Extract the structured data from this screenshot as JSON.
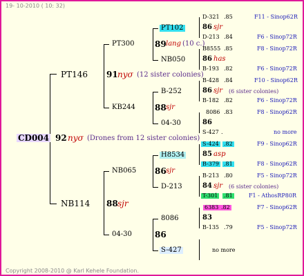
{
  "timestamp": "19- 10-2010 ( 10: 32)",
  "footer": "Copyright 2008-2010 @ Karl Kehele Foundation.",
  "root": {
    "id": "CD004",
    "year": "92",
    "race": "nyσ",
    "note": "(Drones from 12 sister colonies)"
  },
  "gen1": [
    {
      "id": "PT146",
      "year": "91",
      "race": "nyσ",
      "note": "(12 sister colonies)"
    },
    {
      "id": "NB114",
      "year": "88",
      "race": "sjr",
      "note": ""
    }
  ],
  "gen2": [
    {
      "id": "PT300",
      "year": "89",
      "race": "lang",
      "note": "(10 c.)"
    },
    {
      "id": "KB244",
      "year": "88",
      "race": "sjr",
      "note": ""
    },
    {
      "id": "NB065",
      "year": "86",
      "race": "sjr",
      "note": ""
    },
    {
      "id": "04-30",
      "year": "86",
      "race": "",
      "note": ""
    }
  ],
  "gen3": [
    {
      "id": "PT102",
      "year": "",
      "race": ""
    },
    {
      "id": "NB050",
      "year": "86",
      "race": "has"
    },
    {
      "id": "B-252",
      "year": "86",
      "race": "sjr",
      "note": "(6 sister colonies)"
    },
    {
      "id": "04-30",
      "year": "86",
      "race": ""
    },
    {
      "id": "H8534",
      "year": "85",
      "race": "asp"
    },
    {
      "id": "D-213",
      "year": "84",
      "race": "sjr",
      "note": "(6 sister colonies)"
    },
    {
      "id": "8086",
      "year": "83",
      "race": ""
    },
    {
      "id": "S-427",
      "year": "",
      "race": ""
    }
  ],
  "gen4": [
    {
      "id": "D-321",
      "val": ".85",
      "year": "86",
      "race": "sjr",
      "station": "F11 - Sinop62R"
    },
    {
      "id": "D-213",
      "val": ".84",
      "station": "F6 - Sinop72R"
    },
    {
      "id": "B8555",
      "val": ".85",
      "station": "F8 - Sinop72R"
    },
    {
      "id": "B-193",
      "val": ".82",
      "station": "F6 - Sinop72R"
    },
    {
      "id": "B-428",
      "val": ".84",
      "station": "F10 - Sinop62R"
    },
    {
      "id": "B-182",
      "val": ".82",
      "station": "F6 - Sinop72R"
    },
    {
      "id": "8086",
      "val": ".83",
      "station": "F8 - Sinop62R"
    },
    {
      "id": "S-427",
      "val": ".",
      "station": "no more"
    },
    {
      "id": "S-424",
      "val": ".82",
      "station": "F9 - Sinop62R"
    },
    {
      "id": "B-379",
      "val": ".81",
      "station": "F8 - Sinop62R"
    },
    {
      "id": "B-213",
      "val": ".80",
      "station": "F5 - Sinop72R"
    },
    {
      "id": "T-301",
      "val": ".81",
      "station": "F1 - AthosRP80R"
    },
    {
      "id": "6383",
      "val": ".82",
      "station": "F7 - Sinop62R"
    },
    {
      "id": "B-135",
      "val": ".79",
      "station": "F5 - Sinop72R"
    },
    {
      "station": "no more"
    }
  ],
  "colors": {
    "border": "#e0189a",
    "background": "#ffffe8",
    "race": "#c00000",
    "station": "#1a1ab8",
    "cyan": "#33e0f0",
    "green": "#30e070",
    "pink": "#ff55dd"
  }
}
